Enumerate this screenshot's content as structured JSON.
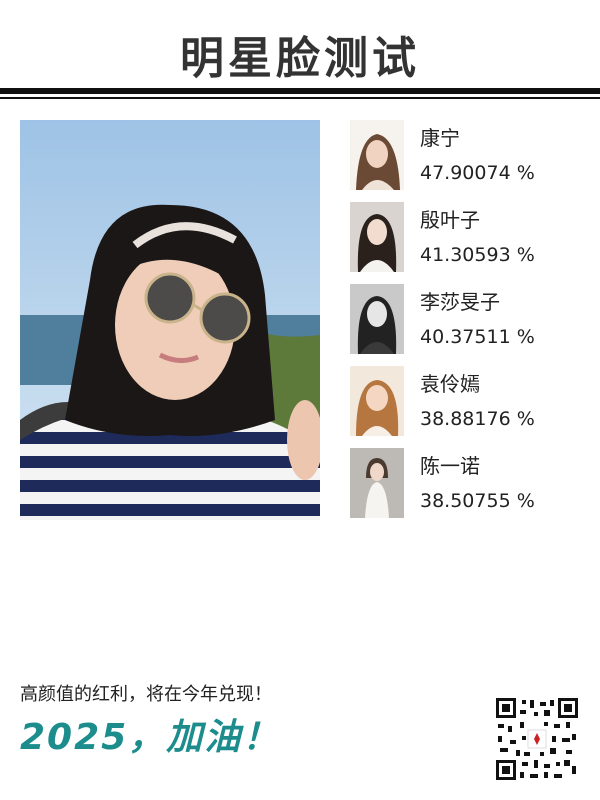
{
  "header": {
    "title": "明星脸测试"
  },
  "main_photo": {
    "icon": "user-photo"
  },
  "results": [
    {
      "name": "康宁",
      "percent": "47.90074 %",
      "icon": "celebrity-photo"
    },
    {
      "name": "殷叶子",
      "percent": "41.30593 %",
      "icon": "celebrity-photo"
    },
    {
      "name": "李莎旻子",
      "percent": "40.37511 %",
      "icon": "celebrity-photo"
    },
    {
      "name": "袁伶嫣",
      "percent": "38.88176 %",
      "icon": "celebrity-photo"
    },
    {
      "name": "陈一诺",
      "percent": "38.50755 %",
      "icon": "celebrity-photo"
    }
  ],
  "footer": {
    "slogan": "高颜值的红利，将在今年兑现！",
    "cheer": "2025，加油！",
    "qr_icon": "qr-code-icon"
  },
  "colors": {
    "accent": "#1c8c8c",
    "rule": "#111111",
    "title": "#333333"
  }
}
